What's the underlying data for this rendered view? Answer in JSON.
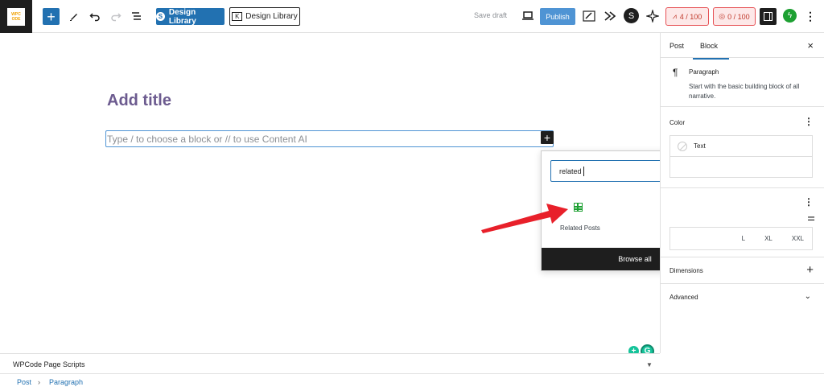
{
  "app": {
    "logo_text": "WPC ODE"
  },
  "toolbar": {
    "add_block": "+",
    "design_library_primary": "Design Library",
    "design_library_secondary": "Design Library",
    "save_draft": "Save draft",
    "publish": "Publish",
    "seo_score": "4 / 100",
    "readability_score": "0 / 100",
    "more": "⋮"
  },
  "editor": {
    "title_placeholder": "Add title",
    "paragraph_placeholder": "Type / to choose a block or // to use Content AI",
    "inserter_plus": "+"
  },
  "inserter_popover": {
    "search_value": "related",
    "clear": "×",
    "results": [
      {
        "label": "Related Posts",
        "icon": "table-grid-icon"
      }
    ],
    "browse_all": "Browse all"
  },
  "sidebar": {
    "tabs": [
      "Post",
      "Block"
    ],
    "active_tab": "Block",
    "close": "×",
    "block_card": {
      "icon": "¶",
      "name": "Paragraph",
      "description": "Start with the basic building block of all narrative."
    },
    "color_panel": {
      "title": "Color",
      "items": [
        "Text",
        ""
      ]
    },
    "typography_panel": {
      "sizes": [
        "L",
        "XL",
        "XXL"
      ]
    },
    "dimensions_panel": {
      "title": "Dimensions",
      "action": "+"
    },
    "advanced_panel": {
      "title": "Advanced"
    }
  },
  "metabox": {
    "title": "WPCode Page Scripts"
  },
  "breadcrumb": {
    "items": [
      "Post",
      "Paragraph"
    ],
    "separator": "›"
  },
  "colors": {
    "accent": "#2271b1",
    "annotation_arrow": "#e8202a",
    "block_icon": "#1da032",
    "title_placeholder": "#6c5b8f"
  }
}
